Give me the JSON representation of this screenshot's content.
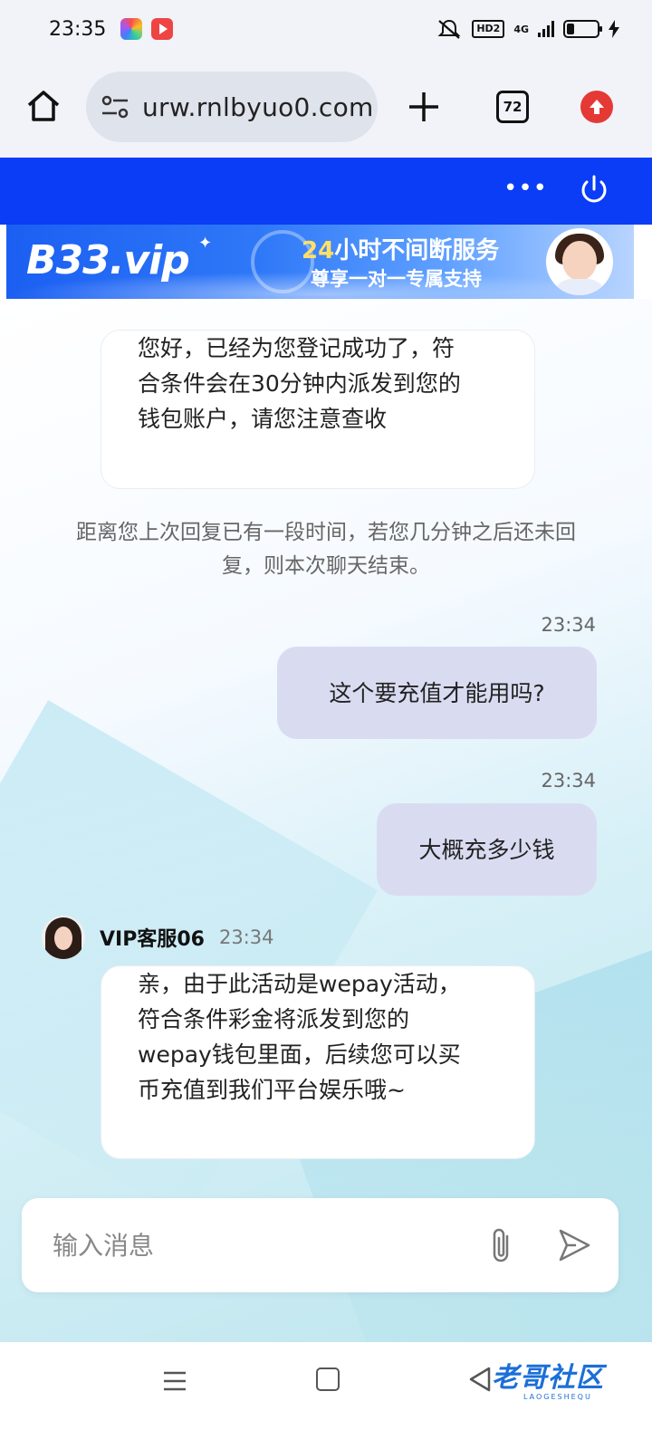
{
  "status_bar": {
    "time": "23:35",
    "network": "4G",
    "hd_label": "HD2",
    "battery_level": 0.25
  },
  "browser": {
    "url": "urw.rnlbyuo0.com",
    "tab_count": "72"
  },
  "banner": {
    "logo": "B33.vip",
    "line1_num": "24",
    "line1_text": "小时不间断服务",
    "line2": "尊享一对一专属支持"
  },
  "chat": {
    "messages": [
      {
        "from": "agent",
        "text_lines": [
          "您好，已经为您登记成功了，符",
          "合条件会在30分钟内派发到您的",
          "钱包账户，请您注意查收"
        ]
      },
      {
        "from": "system",
        "text_lines": [
          "距离您上次回复已有一段时间，若您几分钟之后还未回",
          "复，则本次聊天结束。"
        ]
      },
      {
        "from": "user",
        "time": "23:34",
        "text": "这个要充值才能用吗?"
      },
      {
        "from": "user",
        "time": "23:34",
        "text": "大概充多少钱"
      },
      {
        "from": "agent",
        "name": "VIP客服06",
        "time": "23:34",
        "text_lines": [
          "亲，由于此活动是wepay活动，",
          "符合条件彩金将派发到您的",
          "wepay钱包里面，后续您可以买",
          "币充值到我们平台娱乐哦~"
        ]
      }
    ]
  },
  "input": {
    "placeholder": "输入消息"
  },
  "watermark": {
    "title": "老哥社区",
    "sub": "LAOGESHEQU"
  },
  "colors": {
    "header_blue": "#0a3df5",
    "user_bubble": "#d9dcf1",
    "update_red": "#e53935"
  }
}
